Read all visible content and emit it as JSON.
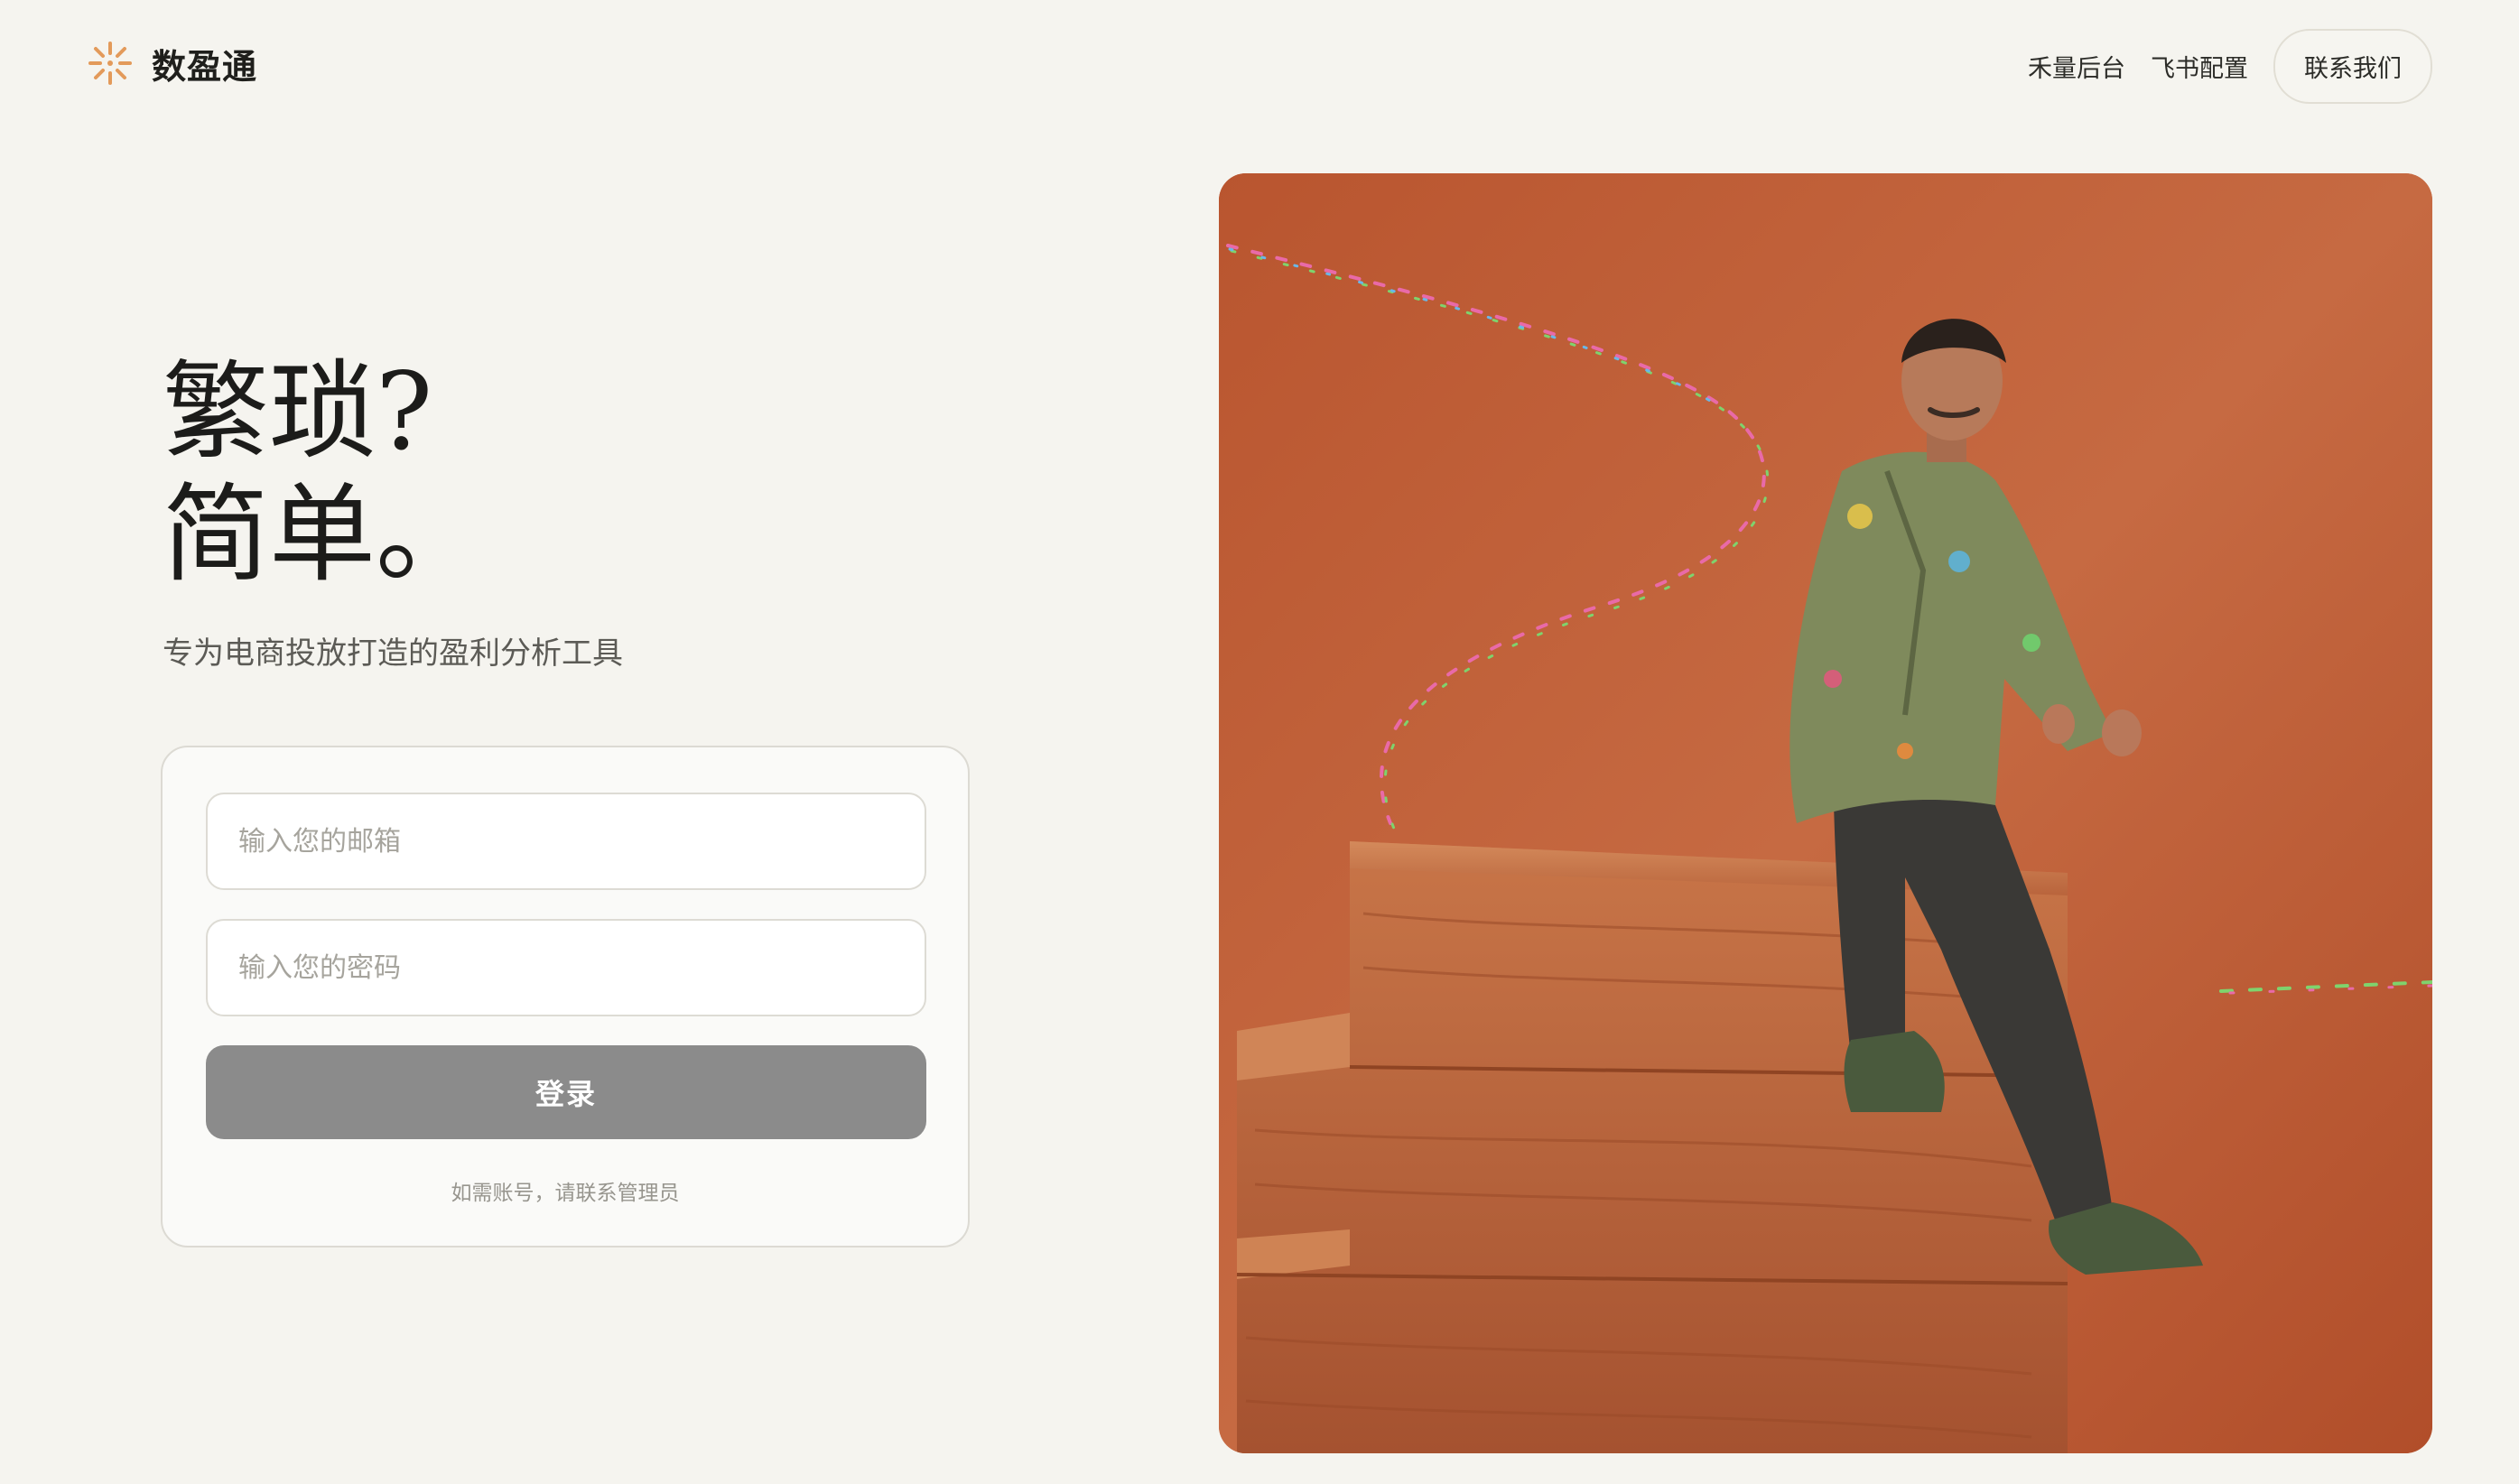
{
  "brand": {
    "name": "数盈通",
    "logo_icon": "sparkle-icon",
    "accent_color": "#e39a5a"
  },
  "nav": {
    "items": [
      {
        "label": "禾量后台"
      },
      {
        "label": "飞书配置"
      }
    ],
    "contact_label": "联系我们"
  },
  "hero": {
    "headline_line1": "繁琐?",
    "headline_line2": "简单。",
    "subtitle": "专为电商投放打造的盈利分析工具"
  },
  "login": {
    "email_placeholder": "输入您的邮箱",
    "email_value": "",
    "password_placeholder": "输入您的密码",
    "password_value": "",
    "submit_label": "登录",
    "hint": "如需账号，请联系管理员"
  },
  "image": {
    "subject": "man-on-wooden-steps-illustration",
    "background_color": "#c2603a"
  }
}
